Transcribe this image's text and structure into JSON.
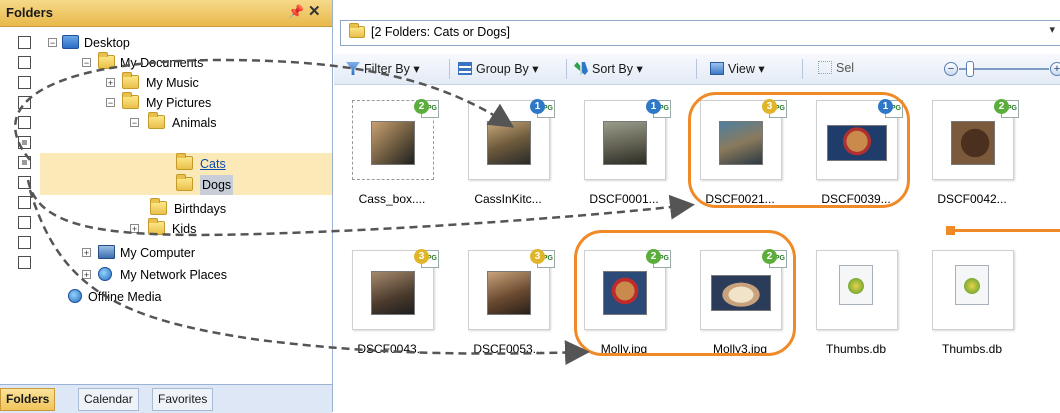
{
  "folders_panel": {
    "title": "Folders",
    "pin_label": "📌",
    "close_label": "✕",
    "tree": [
      {
        "label": "Desktop",
        "icon": "desktop-icon",
        "expander": "−"
      },
      {
        "label": "My Documents",
        "icon": "documents-folder-icon",
        "expander": "−"
      },
      {
        "label": "My Music",
        "icon": "music-folder-icon",
        "expander": "+"
      },
      {
        "label": "My Pictures",
        "icon": "pictures-folder-icon",
        "expander": "−"
      },
      {
        "label": "Animals",
        "icon": "folder-icon",
        "expander": "−"
      },
      {
        "label": "Cats",
        "icon": "folder-icon",
        "expander": ""
      },
      {
        "label": "Dogs",
        "icon": "folder-icon",
        "expander": ""
      },
      {
        "label": "Birthdays",
        "icon": "folder-icon",
        "expander": ""
      },
      {
        "label": "Kids",
        "icon": "folder-icon",
        "expander": "+"
      },
      {
        "label": "My Computer",
        "icon": "computer-icon",
        "expander": "+"
      },
      {
        "label": "My Network Places",
        "icon": "network-icon",
        "expander": "+"
      },
      {
        "label": "Offline Media",
        "icon": "offline-media-icon",
        "expander": ""
      }
    ],
    "tabs": [
      "Folders",
      "Calendar",
      "Favorites"
    ]
  },
  "address_bar": {
    "text": "[2 Folders: Cats or Dogs]"
  },
  "toolbar": {
    "filter_by": "Filter By",
    "group_by": "Group By",
    "sort_by": "Sort By",
    "view": "View",
    "select": "Sel"
  },
  "thumbnails": [
    {
      "label": "Cass_box....",
      "badge": "2",
      "badge_color": "#5cae3c"
    },
    {
      "label": "CassInKitc...",
      "badge": "1",
      "badge_color": "#2f78c8"
    },
    {
      "label": "DSCF0001...",
      "badge": "1",
      "badge_color": "#2f78c8"
    },
    {
      "label": "DSCF0021...",
      "badge": "3",
      "badge_color": "#e0b52a"
    },
    {
      "label": "DSCF0039...",
      "badge": "1",
      "badge_color": "#2f78c8"
    },
    {
      "label": "DSCF0042...",
      "badge": "2",
      "badge_color": "#5cae3c"
    },
    {
      "label": "DSCF0043...",
      "badge": "3",
      "badge_color": "#e0b52a"
    },
    {
      "label": "DSCF0053...",
      "badge": "3",
      "badge_color": "#e0b52a"
    },
    {
      "label": "Molly.jpg",
      "badge": "2",
      "badge_color": "#5cae3c"
    },
    {
      "label": "Molly3.jpg",
      "badge": "2",
      "badge_color": "#5cae3c"
    },
    {
      "label": "Thumbs.db",
      "badge": "",
      "badge_color": ""
    },
    {
      "label": "Thumbs.db",
      "badge": "",
      "badge_color": ""
    }
  ],
  "jpg_tag": "JPG",
  "colors": {
    "accent_orange": "#f08a27",
    "selection": "#fbe9b7",
    "link_blue": "#0a4db3"
  }
}
